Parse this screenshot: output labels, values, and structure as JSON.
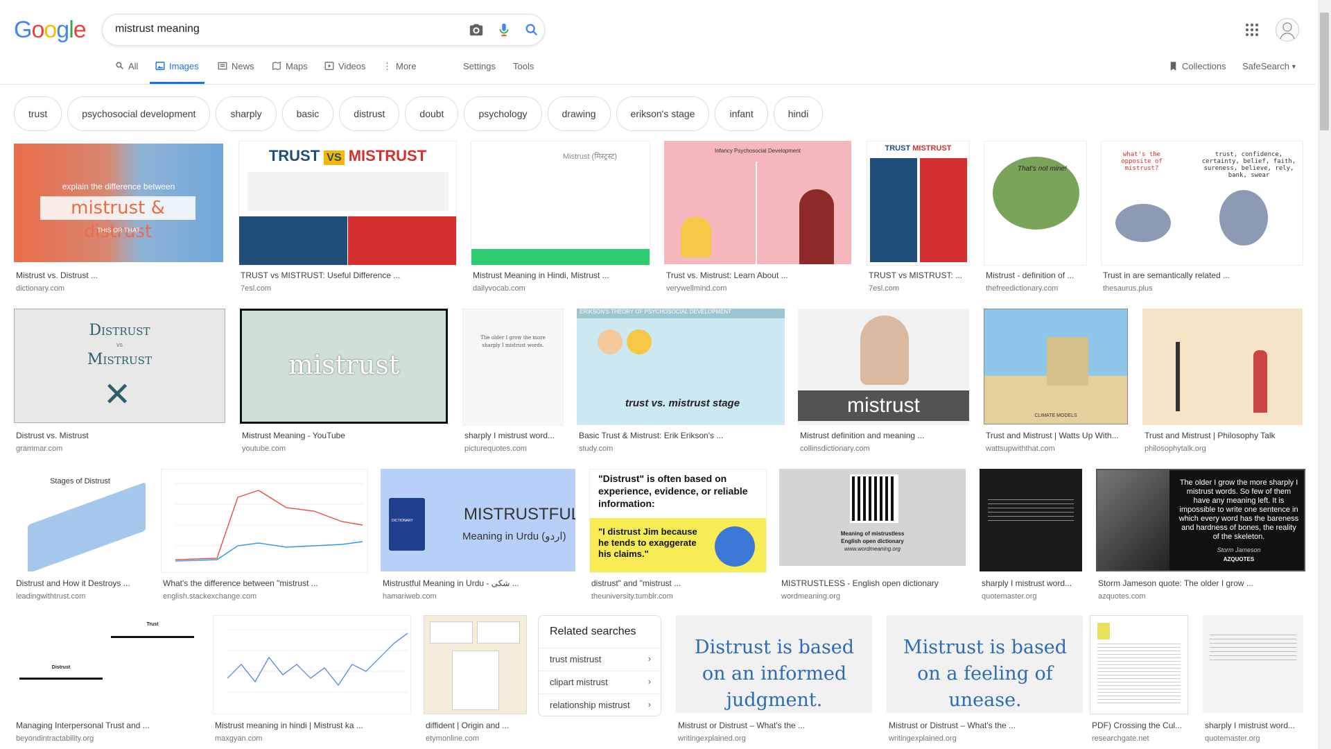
{
  "logo": "Google",
  "search": {
    "query": "mistrust meaning"
  },
  "nav": {
    "all": "All",
    "images": "Images",
    "news": "News",
    "maps": "Maps",
    "videos": "Videos",
    "more": "More",
    "settings": "Settings",
    "tools": "Tools",
    "collections": "Collections",
    "safesearch": "SafeSearch"
  },
  "chips": [
    "trust",
    "psychosocial development",
    "sharply",
    "basic",
    "distrust",
    "doubt",
    "psychology",
    "drawing",
    "erikson's stage",
    "infant",
    "hindi"
  ],
  "results": [
    {
      "caption": "Mistrust vs. Distrust ...",
      "source": "dictionary.com",
      "thumb_text": "explain the difference between",
      "thumb_text2": "mistrust & distrust",
      "thumb_text3": "THIS OR THAT"
    },
    {
      "caption": "TRUST vs MISTRUST: Useful Difference ...",
      "source": "7esl.com",
      "thumb_text": "TRUST",
      "thumb_text2": "VS",
      "thumb_text3": "MISTRUST"
    },
    {
      "caption": "Mistrust Meaning in Hindi, Mistrust ...",
      "source": "dailyvocab.com",
      "thumb_text": "Mistrust (मिस्ट्रस्ट)"
    },
    {
      "caption": "Trust vs. Mistrust: Learn About ...",
      "source": "verywellmind.com",
      "thumb_text": "Infancy Psychosocial Development"
    },
    {
      "caption": "TRUST vs MISTRUST: ...",
      "source": "7esl.com",
      "thumb_text": "TRUST",
      "thumb_text2": "MISTRUST"
    },
    {
      "caption": "Mistrust - definition of ...",
      "source": "thefreedictionary.com",
      "thumb_text": "That's not mine!"
    },
    {
      "caption": "Trust in are semantically related ...",
      "source": "thesaurus.plus",
      "thumb_text": "what's the opposite of mistrust?",
      "thumb_text2": "trust, confidence, certainty, belief, faith, sureness, believe, rely, bank, swear"
    },
    {
      "caption": "Distrust vs. Mistrust",
      "source": "grammar.com",
      "thumb_text": "Distrust",
      "thumb_text2": "vs",
      "thumb_text3": "Mistrust"
    },
    {
      "caption": "Mistrust Meaning - YouTube",
      "source": "youtube.com",
      "thumb_text": "mistrust"
    },
    {
      "caption": "sharply I mistrust word...",
      "source": "picturequotes.com",
      "thumb_text": "The older I grow the more sharply I mistrust words."
    },
    {
      "caption": "Basic Trust & Mistrust: Erik Erikson's ...",
      "source": "study.com",
      "thumb_text": "ERIKSON'S THEORY OF PSYCHOSOCIAL DEVELOPMENT",
      "thumb_text2": "trust vs. mistrust stage"
    },
    {
      "caption": "Mistrust definition and meaning ...",
      "source": "collinsdictionary.com",
      "thumb_text": "mistrust"
    },
    {
      "caption": "Trust and Mistrust | Watts Up With...",
      "source": "wattsupwiththat.com",
      "thumb_text": "CLIMATE MODELS"
    },
    {
      "caption": "Trust and Mistrust | Philosophy Talk",
      "source": "philosophytalk.org"
    },
    {
      "caption": "Distrust and How it Destroys ...",
      "source": "leadingwithtrust.com",
      "thumb_text": "Stages of Distrust"
    },
    {
      "caption": "What's the difference between \"mistrust ...",
      "source": "english.stackexchange.com"
    },
    {
      "caption": "Mistrustful Meaning in Urdu - شکی ...",
      "source": "hamariweb.com",
      "thumb_text": "MISTRUSTFUL",
      "thumb_text2": "Meaning in Urdu (اردو)",
      "thumb_text3": "DICTIONARY"
    },
    {
      "caption": "distrust\" and \"mistrust ...",
      "source": "theuniversity.tumblr.com",
      "thumb_text": "\"Distrust\" is often based on experience, evidence, or reliable information:",
      "thumb_text2": "\"I distrust Jim because he tends to exaggerate his claims.\""
    },
    {
      "caption": "MISTRUSTLESS - English open dictionary",
      "source": "wordmeaning.org",
      "thumb_text": "Meaning of mistrustless",
      "thumb_text2": "English open dictionary",
      "thumb_text3": "www.wordmeaning.org"
    },
    {
      "caption": "sharply I mistrust word...",
      "source": "quotemaster.org"
    },
    {
      "caption": "Storm Jameson quote: The older I grow ...",
      "source": "azquotes.com",
      "thumb_text": "The older I grow the more sharply I mistrust words. So few of them have any meaning left. It is impossible to write one sentence in which every word has the bareness and hardness of bones, the reality of the skeleton.",
      "thumb_text2": "Storm Jameson",
      "thumb_text3": "AZQUOTES"
    },
    {
      "caption": "Managing Interpersonal Trust and ...",
      "source": "beyondintractability.org",
      "thumb_text": "Trust",
      "thumb_text2": "Distrust"
    },
    {
      "caption": "Mistrust meaning in hindi | Mistrust ka ...",
      "source": "maxgyan.com"
    },
    {
      "caption": "diffident | Origin and ...",
      "source": "etymonline.com"
    },
    {
      "caption": "Mistrust or Distrust – What's the ...",
      "source": "writingexplained.org",
      "thumb_text": "Distrust is based on an informed judgment."
    },
    {
      "caption": "Mistrust or Distrust – What's the ...",
      "source": "writingexplained.org",
      "thumb_text": "Mistrust is based on a feeling of unease."
    },
    {
      "caption": "PDF) Crossing the Cul...",
      "source": "researchgate.net"
    },
    {
      "caption": "sharply I mistrust word...",
      "source": "quotemaster.org"
    }
  ],
  "related": {
    "title": "Related searches",
    "items": [
      "trust mistrust",
      "clipart mistrust",
      "relationship mistrust"
    ]
  },
  "colors": {
    "accent": "#1a73e8",
    "border": "#dfe1e5"
  }
}
